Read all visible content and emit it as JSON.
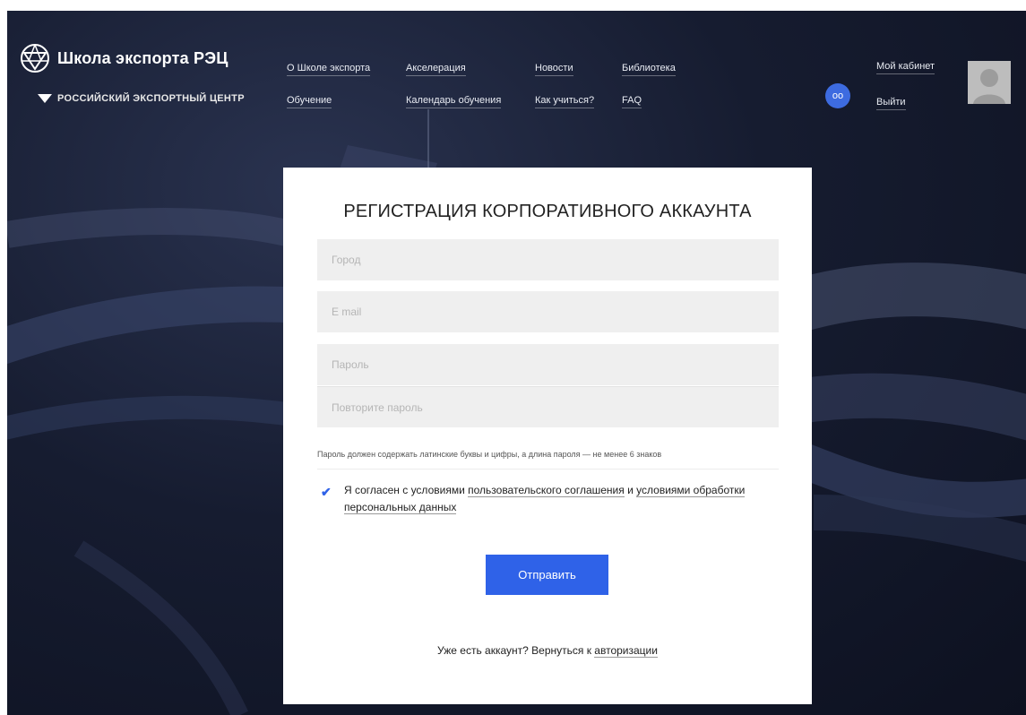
{
  "header": {
    "logo_title": "Школа экспорта РЭЦ",
    "logo_subtitle": "РОССИЙСКИЙ ЭКСПОРТНЫЙ ЦЕНТР",
    "nav": {
      "about": "О Школе экспорта",
      "acceleration": "Акселерация",
      "news": "Новости",
      "library": "Библиотека",
      "training": "Обучение",
      "calendar": "Календарь обучения",
      "how_to_study": "Как учиться?",
      "faq": "FAQ"
    },
    "cabinet_icon": "oo",
    "cabinet_label": "Мой кабинет",
    "logout_label": "Выйти"
  },
  "form": {
    "title": "РЕГИСТРАЦИЯ КОРПОРАТИВНОГО АККАУНТА",
    "city_placeholder": "Город",
    "email_placeholder": "E mail",
    "password_placeholder": "Пароль",
    "repeat_password_placeholder": "Повторите пароль",
    "password_hint": "Пароль должен содержать латинские буквы и цифры, а длина пароля — не менее 6 знаков",
    "agree_prefix": "Я согласен с условиями ",
    "agree_link_terms": "пользовательского соглашения",
    "agree_middle": " и ",
    "agree_link_data": "условиями обработки персональных данных",
    "agree_checked": true,
    "submit_label": "Отправить",
    "have_account": "Уже есть аккаунт? Вернуться к ",
    "login_link": "авторизации"
  },
  "colors": {
    "accent": "#2f62e8",
    "avatar_bg": "#bdbdbd",
    "field_bg": "#efefef"
  }
}
